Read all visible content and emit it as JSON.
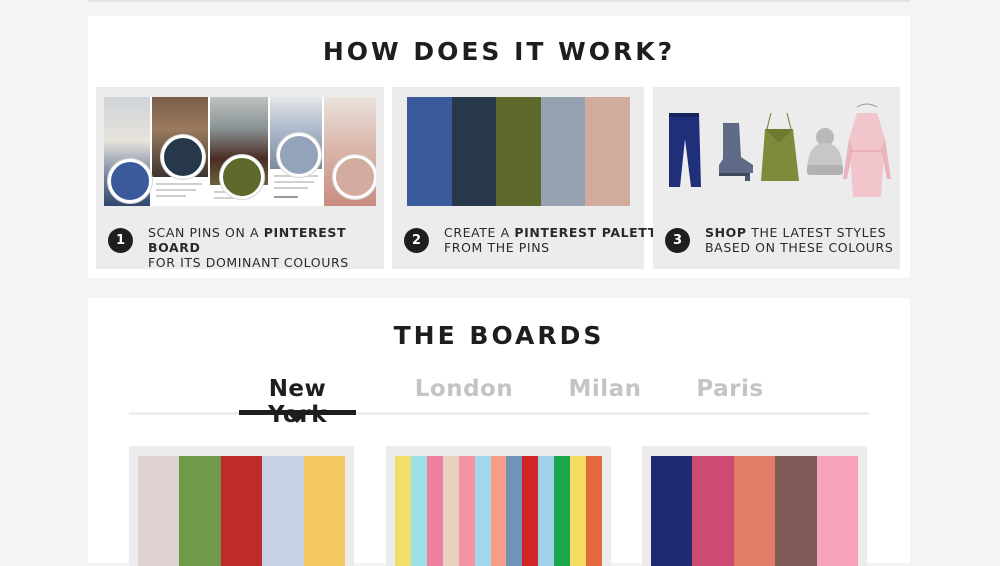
{
  "how": {
    "title": "HOW DOES IT WORK?",
    "steps": [
      {
        "number": "1",
        "line1_pre": "SCAN PINS ON A ",
        "line1_bold": "PINTEREST BOARD",
        "line2": "FOR ITS DOMINANT COLOURS",
        "pin_colors": [
          "#3a5a9c",
          "#27384a",
          "#5e6a2c",
          "#93a4ba",
          "#d4ab9f"
        ]
      },
      {
        "number": "2",
        "line1_pre": "CREATE A ",
        "line1_bold": "PINTEREST PALETTE",
        "line2": "FROM THE PINS",
        "palette": [
          "#3a5a9c",
          "#27384a",
          "#5e6a2c",
          "#96a2b0",
          "#d1ab9c"
        ]
      },
      {
        "number": "3",
        "line1_bold": "SHOP",
        "line1_post": " THE LATEST STYLES",
        "line2": "BASED ON THESE COLOURS"
      }
    ]
  },
  "boards": {
    "title": "THE BOARDS",
    "tabs": [
      "New York",
      "London",
      "Milan",
      "Paris"
    ],
    "active_tab": "New York",
    "palettes": [
      [
        "#e0d2d0",
        "#6f9a4a",
        "#bf2a2a",
        "#c8d0e6",
        "#f4c860"
      ],
      [
        "#f1df6c",
        "#9fdfe8",
        "#ef7f9e",
        "#e7d2c2",
        "#f393a4",
        "#9fd7ed",
        "#f79c87",
        "#7193b8",
        "#d12626",
        "#9fd2e9",
        "#1aa74b",
        "#f3dd61",
        "#e3683b"
      ],
      [
        "#1f2a72",
        "#cd4b73",
        "#e37c67",
        "#7f5a57",
        "#f8a3bc"
      ]
    ]
  }
}
